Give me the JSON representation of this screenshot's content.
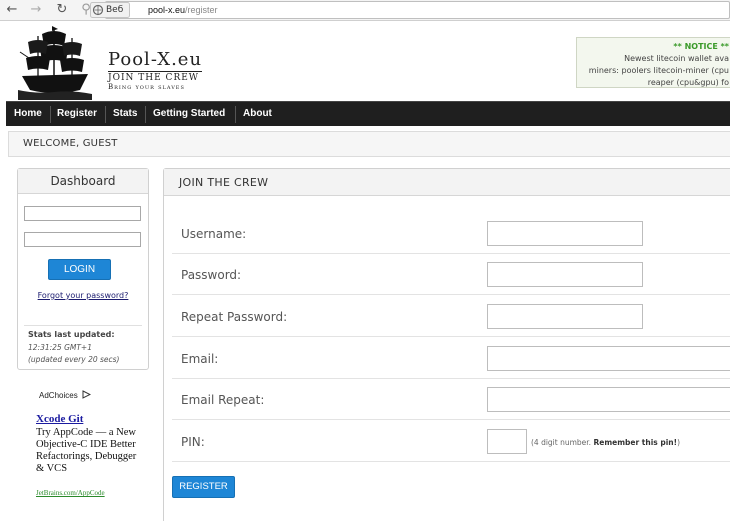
{
  "browser": {
    "site_badge": "Веб",
    "url_host": "pool-x.eu",
    "url_path": "/register"
  },
  "header": {
    "brand_name": "Pool-X.eu",
    "brand_tagline1": "JOIN THE CREW",
    "brand_tagline2": "Bring your slaves",
    "notice_title": "** NOTICE **",
    "notice_line1": "Newest litecoin wallet ava",
    "notice_line2": "miners: poolers litecoin-miner (cpu",
    "notice_line3": "reaper (cpu&gpu) fo"
  },
  "nav": {
    "items": [
      "Home",
      "Register",
      "Stats",
      "Getting Started",
      "About"
    ]
  },
  "welcome": "WELCOME, GUEST",
  "sidebar": {
    "title": "Dashboard",
    "username_value": "",
    "password_value": "",
    "login_label": "LOGIN",
    "forgot_label": "Forgot your password?",
    "stats_label": "Stats last updated:",
    "stats_time": "12:31:25 GMT+1",
    "stats_note": "(updated every 20 secs)"
  },
  "ad": {
    "adchoices": "AdChoices",
    "title": "Xcode Git",
    "body": "Try AppCode — a New Objective-C IDE Better Refactorings, Debugger & VCS",
    "url": "JetBrains.com/AppCode"
  },
  "form": {
    "title": "JOIN THE CREW",
    "fields": [
      {
        "label": "Username:",
        "value": ""
      },
      {
        "label": "Password:",
        "value": ""
      },
      {
        "label": "Repeat Password:",
        "value": ""
      },
      {
        "label": "Email:",
        "value": ""
      },
      {
        "label": "Email Repeat:",
        "value": ""
      },
      {
        "label": "PIN:",
        "value": ""
      }
    ],
    "pin_hint_prefix": "(4 digit number.",
    "pin_hint_bold": "Remember this pin!",
    "pin_hint_suffix": ")",
    "register_label": "REGISTER"
  },
  "colors": {
    "nav_bg": "#1f1f1f",
    "button_blue": "#1e86d6",
    "notice_green": "#3a9a2a"
  }
}
